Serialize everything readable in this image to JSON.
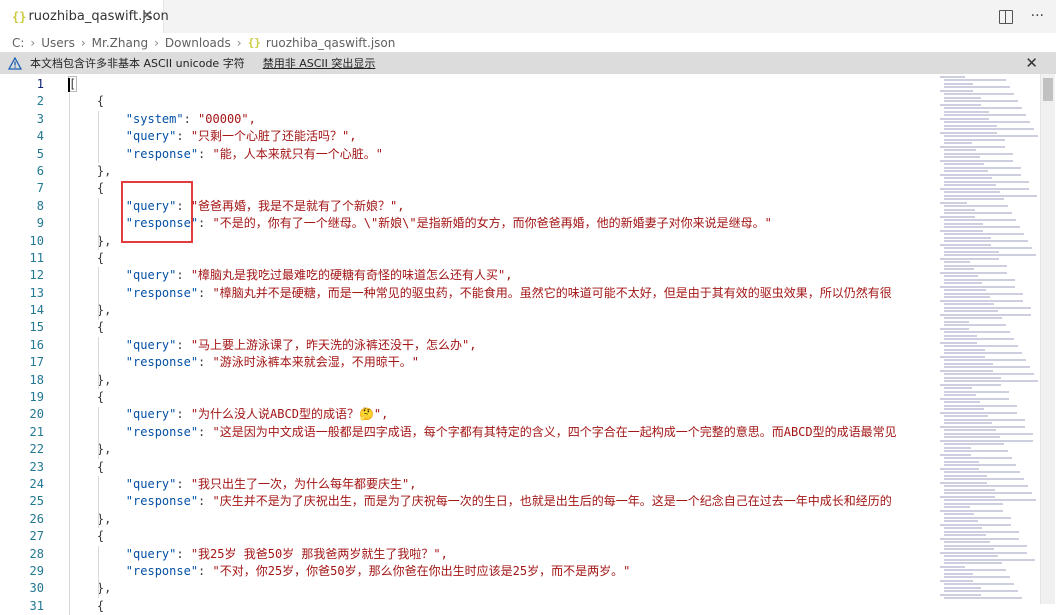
{
  "tab": {
    "label": "ruozhiba_qaswift.json",
    "close": "✕"
  },
  "breadcrumb": [
    "C:",
    "Users",
    "Mr.Zhang",
    "Downloads",
    "ruozhiba_qaswift.json"
  ],
  "notice": {
    "message": "本文档包含许多非基本 ASCII unicode 字符",
    "action": "禁用非 ASCII 突出显示",
    "close": "✕"
  },
  "editor": {
    "line_numbers": [
      "1",
      "2",
      "3",
      "4",
      "5",
      "6",
      "7",
      "8",
      "9",
      "10",
      "11",
      "12",
      "13",
      "14",
      "15",
      "16",
      "17",
      "18",
      "19",
      "20",
      "21",
      "22",
      "23",
      "24",
      "25",
      "26",
      "27",
      "28",
      "29",
      "30",
      "31"
    ],
    "lines": [
      {
        "type": "open-bracket",
        "text": "["
      },
      {
        "type": "brace",
        "text": "{"
      },
      {
        "type": "kv",
        "key": "\"system\"",
        "value": "\"00000\","
      },
      {
        "type": "kv",
        "key": "\"query\"",
        "value": "\"只剩一个心脏了还能活吗？\","
      },
      {
        "type": "kv",
        "key": "\"response\"",
        "value": "\"能，人本来就只有一个心脏。\""
      },
      {
        "type": "brace",
        "text": "},"
      },
      {
        "type": "brace",
        "text": "{"
      },
      {
        "type": "kv",
        "key": "\"query\"",
        "value": "\"爸爸再婚，我是不是就有了个新娘？\","
      },
      {
        "type": "kv",
        "key": "\"response\"",
        "value": "\"不是的，你有了一个继母。\\\"新娘\\\"是指新婚的女方，而你爸爸再婚，他的新婚妻子对你来说是继母。\""
      },
      {
        "type": "brace",
        "text": "},"
      },
      {
        "type": "brace",
        "text": "{"
      },
      {
        "type": "kv",
        "key": "\"query\"",
        "value": "\"樟脑丸是我吃过最难吃的硬糖有奇怪的味道怎么还有人买\","
      },
      {
        "type": "kv",
        "key": "\"response\"",
        "value": "\"樟脑丸并不是硬糖，而是一种常见的驱虫药，不能食用。虽然它的味道可能不太好，但是由于其有效的驱虫效果，所以仍然有很"
      },
      {
        "type": "brace",
        "text": "},"
      },
      {
        "type": "brace",
        "text": "{"
      },
      {
        "type": "kv",
        "key": "\"query\"",
        "value": "\"马上要上游泳课了，昨天洗的泳裤还没干，怎么办\","
      },
      {
        "type": "kv",
        "key": "\"response\"",
        "value": "\"游泳时泳裤本来就会湿，不用晾干。\""
      },
      {
        "type": "brace",
        "text": "},"
      },
      {
        "type": "brace",
        "text": "{"
      },
      {
        "type": "kv",
        "key": "\"query\"",
        "value": "\"为什么没人说ABCD型的成语？🤔\","
      },
      {
        "type": "kv",
        "key": "\"response\"",
        "value": "\"这是因为中文成语一般都是四字成语，每个字都有其特定的含义，四个字合在一起构成一个完整的意思。而ABCD型的成语最常见"
      },
      {
        "type": "brace",
        "text": "},"
      },
      {
        "type": "brace",
        "text": "{"
      },
      {
        "type": "kv",
        "key": "\"query\"",
        "value": "\"我只出生了一次，为什么每年都要庆生\","
      },
      {
        "type": "kv",
        "key": "\"response\"",
        "value": "\"庆生并不是为了庆祝出生，而是为了庆祝每一次的生日，也就是出生后的每一年。这是一个纪念自己在过去一年中成长和经历的"
      },
      {
        "type": "brace",
        "text": "},"
      },
      {
        "type": "brace",
        "text": "{"
      },
      {
        "type": "kv",
        "key": "\"query\"",
        "value": "\"我25岁 我爸50岁 那我爸两岁就生了我啦？\","
      },
      {
        "type": "kv",
        "key": "\"response\"",
        "value": "\"不对，你25岁，你爸50岁，那么你爸在你出生时应该是25岁，而不是两岁。\""
      },
      {
        "type": "brace",
        "text": "},"
      },
      {
        "type": "brace",
        "text": "{"
      }
    ]
  }
}
